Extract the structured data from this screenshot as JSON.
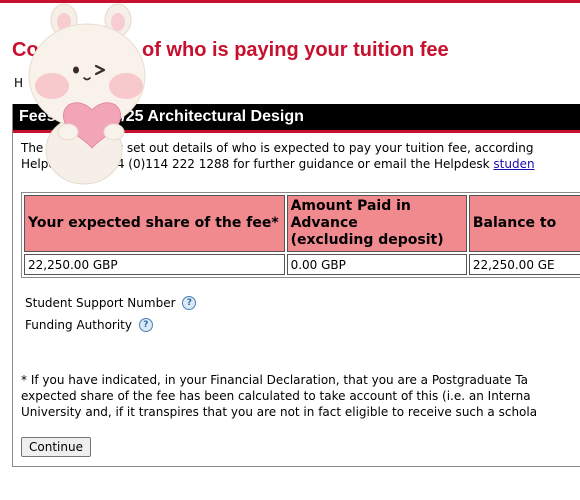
{
  "page": {
    "title": "Confirmation of who is paying your tuition fee",
    "subtext": "H"
  },
  "panel": {
    "header": "Fees for 2024/25 Architectural Design",
    "intro_line1": "The tables below set out details of who is expected to pay your tuition fee, according",
    "intro_line2_prefix": "Helpdesk on +44 (0)114 222 1288 for further guidance or email the Helpdesk ",
    "intro_link": "studen"
  },
  "fees_table": {
    "headers": [
      "Your expected share of the fee*",
      "Amount Paid in Advance\n(excluding deposit)",
      "Balance to"
    ],
    "rows": [
      [
        "22,250.00 GBP",
        "0.00 GBP",
        "22,250.00 GE"
      ]
    ]
  },
  "fields": {
    "student_support_number_label": "Student Support Number",
    "funding_authority_label": "Funding Authority"
  },
  "footnote": {
    "line1": "* If you have indicated, in your Financial Declaration, that you are a Postgraduate Ta",
    "line2": "expected share of the fee has been calculated to take account of this (i.e. an Interna",
    "line3": "University and, if it transpires that you are not in fact eligible to receive such a schola"
  },
  "actions": {
    "continue_label": "Continue"
  },
  "icons": {
    "help": "help-circle-icon",
    "overlay": "bunny-sticker-icon"
  },
  "colors": {
    "accent_red": "#c8102e",
    "header_pink": "#f08a8f",
    "link_blue": "#1a0dab"
  }
}
